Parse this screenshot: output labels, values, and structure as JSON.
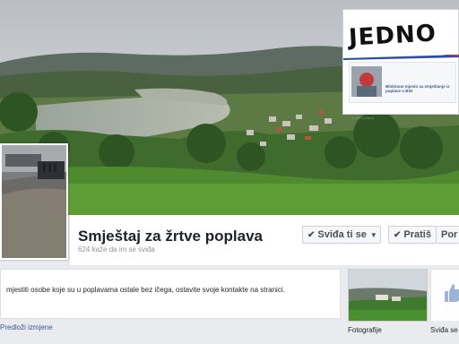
{
  "page": {
    "title": "Smještaj za žrtve poplava",
    "likes_count": "624 kaže da im se sviđa"
  },
  "buttons": {
    "like": "Sviđa ti se",
    "follow": "Pratiš",
    "more": "Por"
  },
  "about": {
    "text": "mjestiti osobe koje su u poplavama ostale bez ičega, ostavite svoje kontakte na stranici.",
    "suggest": "Predloži izmjene"
  },
  "tiles": {
    "photos": "Fotografije",
    "likes": "Sviđa se"
  },
  "ad": {
    "logo": "JEDNO",
    "headline": "Blokirane mjesto za smještanje iz poplave u BiH",
    "small": "nešto o Bosni"
  },
  "colors": {
    "accent": "#3b5998",
    "background": "#e9ebee"
  }
}
